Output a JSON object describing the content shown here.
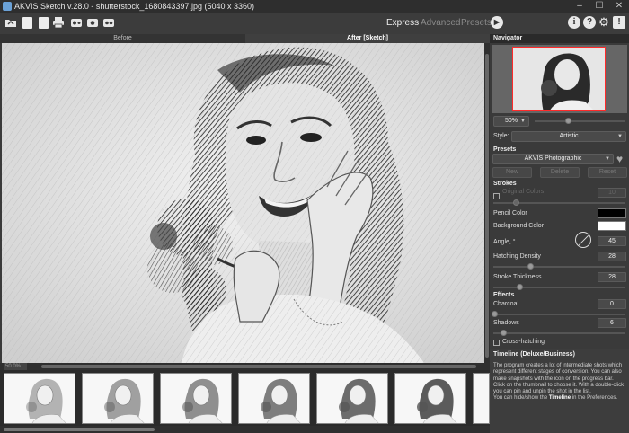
{
  "window": {
    "title": "AKVIS Sketch v.28.0 - shutterstock_1680843397.jpg (5040 x 3360)",
    "minimize_glyph": "–",
    "maximize_glyph": "☐",
    "close_glyph": "✕"
  },
  "toolbar": {
    "icons": [
      "open-icon",
      "save-icon",
      "save-as-icon",
      "print-icon",
      "share-icon",
      "batch-icon",
      "plugins-icon"
    ],
    "modes": {
      "express": "Express",
      "advanced": "Advanced",
      "presets": "Presets"
    },
    "active_mode": "Express",
    "run_glyph": "▶",
    "info_glyph": "i",
    "help_glyph": "?",
    "settings_glyph": "⚙",
    "notifications_glyph": "!"
  },
  "view_tabs": {
    "before": "Before",
    "after": "After [Sketch]"
  },
  "status": {
    "zoom": "50.0%"
  },
  "navigator": {
    "title": "Navigator",
    "zoom": "50%"
  },
  "settings": {
    "style_label": "Style:",
    "style_value": "Artistic",
    "presets_label": "Presets",
    "preset_value": "AKVIS Photographic",
    "new_button": "New",
    "delete_button": "Delete",
    "reset_button": "Reset"
  },
  "strokes": {
    "title": "Strokes",
    "original_colors_label": "Original Colors",
    "original_colors_value": "10",
    "pencil_color_label": "Pencil Color",
    "pencil_color": "#000000",
    "background_color_label": "Background Color",
    "background_color": "#ffffff",
    "angle_label": "Angle, °",
    "angle_value": "45",
    "hatching_density_label": "Hatching Density",
    "hatching_density_value": "28",
    "stroke_thickness_label": "Stroke Thickness",
    "stroke_thickness_value": "28"
  },
  "effects": {
    "title": "Effects",
    "charcoal_label": "Charcoal",
    "charcoal_value": "0",
    "shadows_label": "Shadows",
    "shadows_value": "6",
    "cross_hatching_label": "Cross-hatching"
  },
  "timeline_info": {
    "title": "Timeline (Deluxe/Business)",
    "text_1": "The program creates a lot of intermediate shots which represent different stages of conversion. You can also make snapshots with the icon on the progress bar.",
    "text_2": "Click on the thumbnail to choose it. With a double-click you can pin and unpin the shot in the list.",
    "text_3_pre": "You can hide/show the ",
    "text_3_bold": "Timeline",
    "text_3_post": " in the Preferences."
  },
  "timeline": {
    "thumbnails": 7
  }
}
